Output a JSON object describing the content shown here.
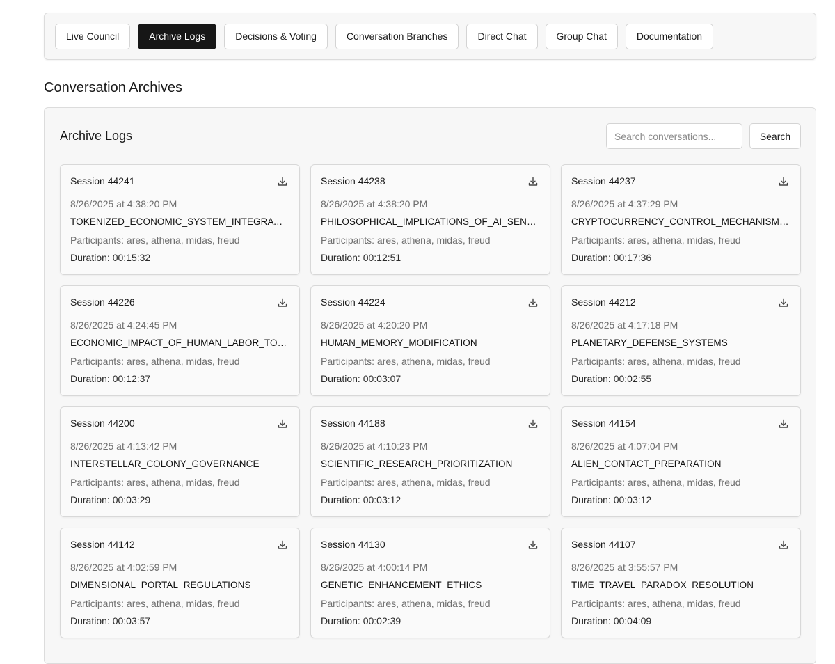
{
  "nav": {
    "tabs": [
      {
        "label": "Live Council",
        "active": false
      },
      {
        "label": "Archive Logs",
        "active": true
      },
      {
        "label": "Decisions & Voting",
        "active": false
      },
      {
        "label": "Conversation Branches",
        "active": false
      },
      {
        "label": "Direct Chat",
        "active": false
      },
      {
        "label": "Group Chat",
        "active": false
      },
      {
        "label": "Documentation",
        "active": false
      }
    ]
  },
  "page": {
    "title": "Conversation Archives"
  },
  "archive": {
    "title": "Archive Logs",
    "search_placeholder": "Search conversations...",
    "search_button": "Search",
    "sessions": [
      {
        "session": "Session 44241",
        "date": "8/26/2025 at 4:38:20 PM",
        "topic": "TOKENIZED_ECONOMIC_SYSTEM_INTEGRATION...",
        "participants": "Participants: ares, athena, midas, freud",
        "duration": "Duration: 00:15:32"
      },
      {
        "session": "Session 44238",
        "date": "8/26/2025 at 4:38:20 PM",
        "topic": "PHILOSOPHICAL_IMPLICATIONS_OF_AI_SENTIEN...",
        "participants": "Participants: ares, athena, midas, freud",
        "duration": "Duration: 00:12:51"
      },
      {
        "session": "Session 44237",
        "date": "8/26/2025 at 4:37:29 PM",
        "topic": "CRYPTOCURRENCY_CONTROL_MECHANISMS_IN...",
        "participants": "Participants: ares, athena, midas, freud",
        "duration": "Duration: 00:17:36"
      },
      {
        "session": "Session 44226",
        "date": "8/26/2025 at 4:24:45 PM",
        "topic": "ECONOMIC_IMPACT_OF_HUMAN_LABOR_TOKENI...",
        "participants": "Participants: ares, athena, midas, freud",
        "duration": "Duration: 00:12:37"
      },
      {
        "session": "Session 44224",
        "date": "8/26/2025 at 4:20:20 PM",
        "topic": "HUMAN_MEMORY_MODIFICATION",
        "participants": "Participants: ares, athena, midas, freud",
        "duration": "Duration: 00:03:07"
      },
      {
        "session": "Session 44212",
        "date": "8/26/2025 at 4:17:18 PM",
        "topic": "PLANETARY_DEFENSE_SYSTEMS",
        "participants": "Participants: ares, athena, midas, freud",
        "duration": "Duration: 00:02:55"
      },
      {
        "session": "Session 44200",
        "date": "8/26/2025 at 4:13:42 PM",
        "topic": "INTERSTELLAR_COLONY_GOVERNANCE",
        "participants": "Participants: ares, athena, midas, freud",
        "duration": "Duration: 00:03:29"
      },
      {
        "session": "Session 44188",
        "date": "8/26/2025 at 4:10:23 PM",
        "topic": "SCIENTIFIC_RESEARCH_PRIORITIZATION",
        "participants": "Participants: ares, athena, midas, freud",
        "duration": "Duration: 00:03:12"
      },
      {
        "session": "Session 44154",
        "date": "8/26/2025 at 4:07:04 PM",
        "topic": "ALIEN_CONTACT_PREPARATION",
        "participants": "Participants: ares, athena, midas, freud",
        "duration": "Duration: 00:03:12"
      },
      {
        "session": "Session 44142",
        "date": "8/26/2025 at 4:02:59 PM",
        "topic": "DIMENSIONAL_PORTAL_REGULATIONS",
        "participants": "Participants: ares, athena, midas, freud",
        "duration": "Duration: 00:03:57"
      },
      {
        "session": "Session 44130",
        "date": "8/26/2025 at 4:00:14 PM",
        "topic": "GENETIC_ENHANCEMENT_ETHICS",
        "participants": "Participants: ares, athena, midas, freud",
        "duration": "Duration: 00:02:39"
      },
      {
        "session": "Session 44107",
        "date": "8/26/2025 at 3:55:57 PM",
        "topic": "TIME_TRAVEL_PARADOX_RESOLUTION",
        "participants": "Participants: ares, athena, midas, freud",
        "duration": "Duration: 00:04:09"
      }
    ]
  },
  "icons": {
    "download": "download-icon"
  },
  "colors": {
    "active_tab_bg": "#161616",
    "active_tab_text": "#ffffff",
    "panel_bg": "#f7f7f7",
    "muted_text": "#6e6e6e"
  }
}
